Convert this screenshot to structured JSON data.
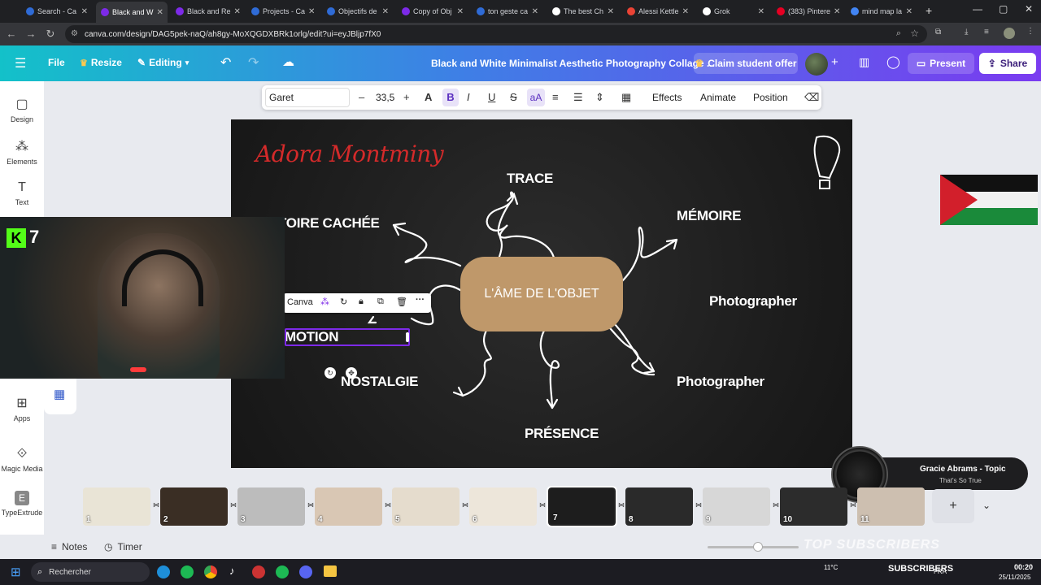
{
  "browser": {
    "tabs": [
      {
        "label": "Search - Ca",
        "color": "#2f6bd6"
      },
      {
        "label": "Black and W",
        "color": "#7d2ae8",
        "active": true
      },
      {
        "label": "Black and Re",
        "color": "#7d2ae8"
      },
      {
        "label": "Projects - Ca",
        "color": "#2f6bd6"
      },
      {
        "label": "Objectifs de",
        "color": "#2f6bd6"
      },
      {
        "label": "Copy of Obj",
        "color": "#7d2ae8"
      },
      {
        "label": "ton geste ca",
        "color": "#2f6bd6"
      },
      {
        "label": "The best Ch",
        "color": "#ffffff"
      },
      {
        "label": "Alessi Kettle",
        "color": "#ea4335"
      },
      {
        "label": "Grok",
        "color": "#ffffff"
      },
      {
        "label": "(383) Pintere",
        "color": "#e60023"
      },
      {
        "label": "mind map la",
        "color": "#4285f4"
      }
    ],
    "url": "canva.com/design/DAG5pek-naQ/ah8gy-MoXQGDXBRk1orlg/edit?ui=eyJBljp7fX0"
  },
  "header": {
    "file": "File",
    "resize": "Resize",
    "editing": "Editing",
    "doc_title": "Black and White Minimalist Aesthetic Photography Collage ...",
    "claim": "Claim student offer",
    "present": "Present",
    "share": "Share"
  },
  "sidebar": {
    "items": [
      {
        "label": "Design",
        "icon": "design-icon"
      },
      {
        "label": "Elements",
        "icon": "elements-icon"
      },
      {
        "label": "Text",
        "icon": "text-icon"
      },
      {
        "label": "Apps",
        "icon": "apps-icon"
      },
      {
        "label": "Magic Media",
        "icon": "magic-media-icon"
      },
      {
        "label": "TypeExtrude",
        "icon": "typeextrude-icon"
      }
    ]
  },
  "toolbar": {
    "font": "Garet",
    "size": "33,5",
    "effects": "Effects",
    "animate": "Animate",
    "position": "Position"
  },
  "slide": {
    "author": "Adora Montminy",
    "center": "L'ÂME DE L'OBJET",
    "nodes": {
      "trace": "TRACE",
      "histoire": "TOIRE CACHÉE",
      "memoire": "MÉMOIRE",
      "photographer1": "Photographer",
      "photographer2": "Photographer",
      "emotion": "MOTION",
      "nostalgie": "NOSTALGIE",
      "presence": "PRÉSENCE"
    }
  },
  "selection_toolbar": {
    "label": "Canva"
  },
  "webcam": {
    "badge": "K 7"
  },
  "pages": [
    {
      "num": "1",
      "color": "#e9e4d6"
    },
    {
      "num": "2",
      "color": "#3a2e24"
    },
    {
      "num": "3",
      "color": "#bcbcbc"
    },
    {
      "num": "4",
      "color": "#d9c7b4"
    },
    {
      "num": "5",
      "color": "#e5dccd"
    },
    {
      "num": "6",
      "color": "#ede6da"
    },
    {
      "num": "7",
      "color": "#1d1d1d",
      "active": true
    },
    {
      "num": "8",
      "color": "#2a2a2a"
    },
    {
      "num": "9",
      "color": "#d7d7d7"
    },
    {
      "num": "10",
      "color": "#2c2c2c"
    },
    {
      "num": "11",
      "color": "#cdbfb0"
    }
  ],
  "music": {
    "artist": "Gracie Abrams - Topic",
    "song": "That's So True"
  },
  "bottom": {
    "notes": "Notes",
    "timer": "Timer"
  },
  "taskbar": {
    "search": "Rechercher",
    "weather": "11°C",
    "subscribers": "SUBSCRIBERS",
    "time": "00:20",
    "date": "25/11/2025",
    "lang": "FRA",
    "overlay": "TOP SUBSCRIBERS"
  }
}
